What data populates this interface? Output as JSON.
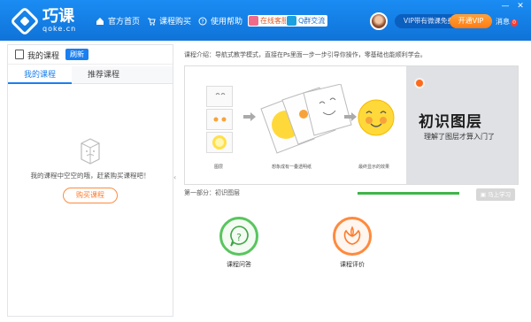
{
  "header": {
    "logo_title": "巧课",
    "logo_sub": "qoke.cn",
    "nav": [
      "官方首页",
      "课程购买",
      "使用帮助"
    ],
    "tag1": "在线客服",
    "tag2": "Q群交流",
    "vip_text": "VIP带有微课免费",
    "vip_button": "开通VIP",
    "messages": "消息",
    "message_count": "0",
    "win_buttons": [
      "—",
      "✕"
    ]
  },
  "left": {
    "title": "我的课程",
    "refresh": "刷新",
    "tabs": [
      "我的课程",
      "推荐课程"
    ],
    "empty_text": "我的课程中空空的哦，赶紧购买课程吧！",
    "buy_button": "购买课程"
  },
  "main": {
    "intro": "课程介绍：导航式教学模式，直接在Ps里面一步一步引导你操作，零基础也能顺利学会。",
    "slide_title": "初识图层",
    "slide_subtitle": "理解了图层才算入门了",
    "captions": [
      "图层",
      "想象成有一叠透明纸",
      "最终显示的效果"
    ],
    "step_text": "第一部分：初识图层",
    "progress": 1.0,
    "mark_button": "马上学习",
    "actions": [
      "课程问答",
      "课程评价"
    ]
  },
  "colors": {
    "brand": "#1a7ff0",
    "accent": "#ff7a2b",
    "green": "#3fb54a"
  }
}
